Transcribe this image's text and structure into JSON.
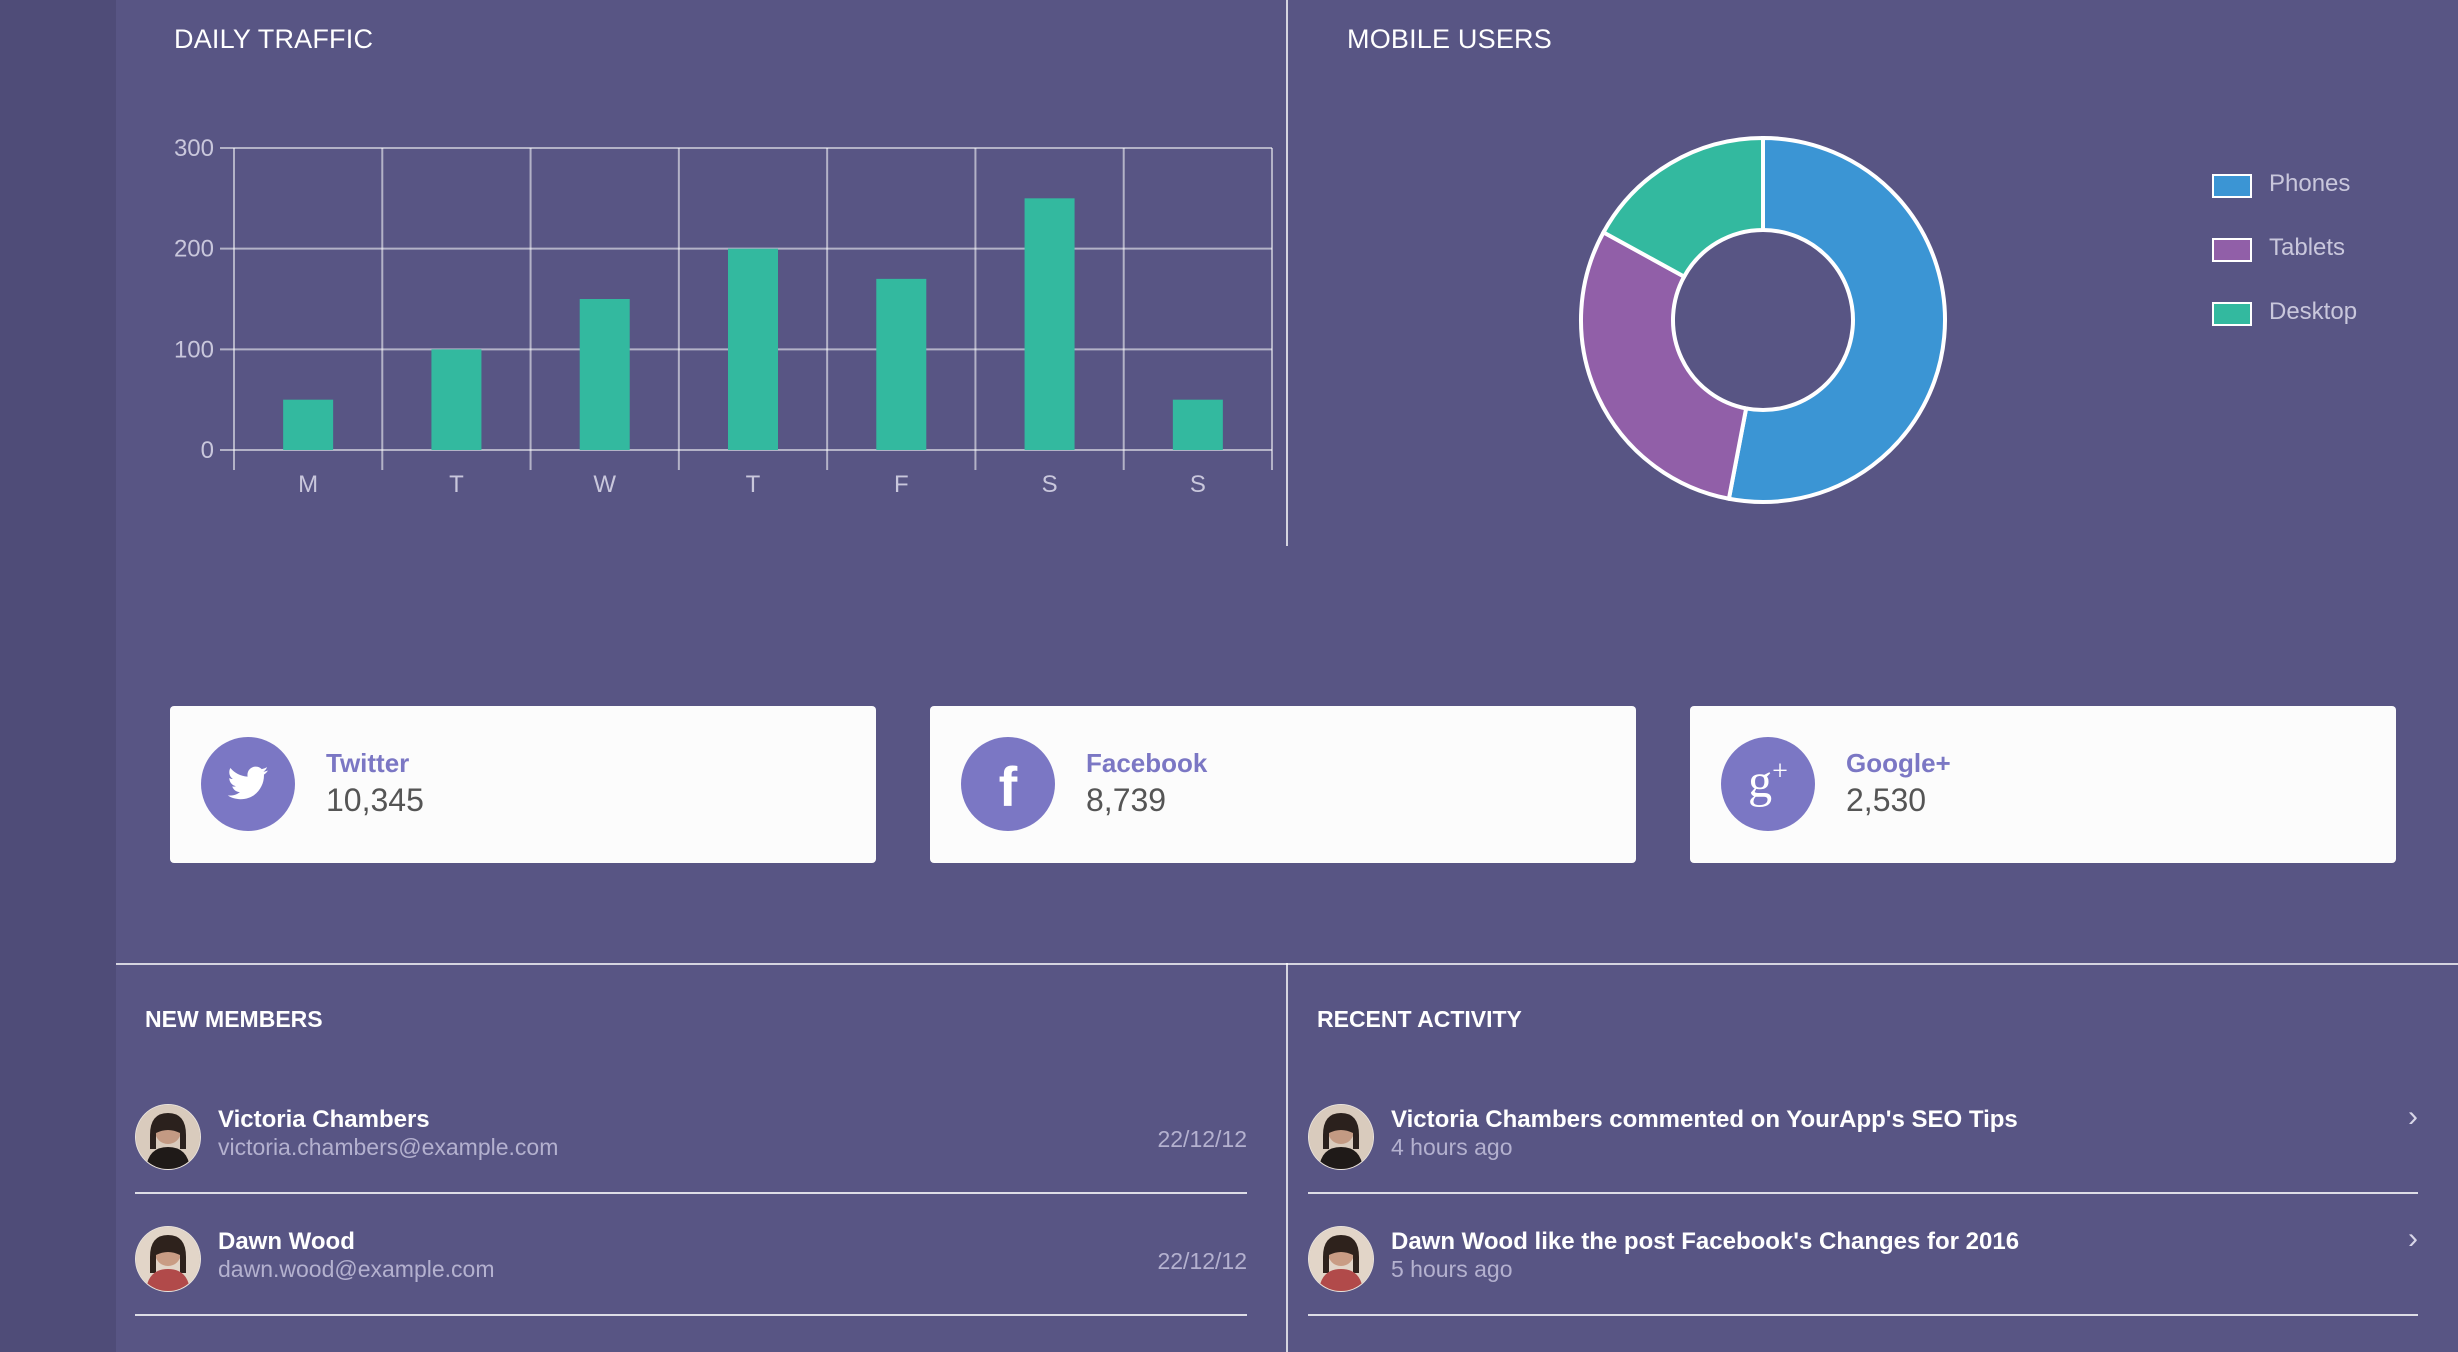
{
  "colors": {
    "background": "#585584",
    "accent": "#7b77c4",
    "bar": "#33b99f",
    "phones": "#3b95d4",
    "tablets": "#915fa8",
    "desktop": "#33b99f"
  },
  "daily_traffic": {
    "title": "DAILY TRAFFIC"
  },
  "mobile_users": {
    "title": "MOBILE USERS"
  },
  "chart_data": [
    {
      "type": "bar",
      "title": "DAILY TRAFFIC",
      "categories": [
        "M",
        "T",
        "W",
        "T",
        "F",
        "S",
        "S"
      ],
      "values": [
        50,
        100,
        150,
        200,
        170,
        250,
        50
      ],
      "yticks": [
        "0",
        "100",
        "200",
        "300"
      ],
      "ylim": [
        0,
        300
      ],
      "grid": true,
      "xlabel": "",
      "ylabel": ""
    },
    {
      "type": "pie",
      "title": "MOBILE USERS",
      "donut": true,
      "labels": [
        "Phones",
        "Tablets",
        "Desktop"
      ],
      "values": [
        53,
        30,
        17
      ],
      "colors": [
        "#3b95d4",
        "#915fa8",
        "#33b99f"
      ],
      "legend": "right"
    }
  ],
  "social": [
    {
      "name": "Twitter",
      "count": "10,345",
      "icon": "twitter-bird-icon"
    },
    {
      "name": "Facebook",
      "count": "8,739",
      "icon": "facebook-f-icon"
    },
    {
      "name": "Google+",
      "count": "2,530",
      "icon": "google-plus-icon"
    }
  ],
  "new_members": {
    "title": "NEW MEMBERS",
    "items": [
      {
        "name": "Victoria Chambers",
        "email": "victoria.chambers@example.com",
        "date": "22/12/12"
      },
      {
        "name": "Dawn Wood",
        "email": "dawn.wood@example.com",
        "date": "22/12/12"
      }
    ]
  },
  "recent_activity": {
    "title": "RECENT ACTIVITY",
    "items": [
      {
        "text": "Victoria Chambers commented on YourApp's SEO Tips",
        "time": "4 hours ago"
      },
      {
        "text": "Dawn Wood like the post Facebook's Changes for 2016",
        "time": "5 hours ago"
      }
    ]
  }
}
